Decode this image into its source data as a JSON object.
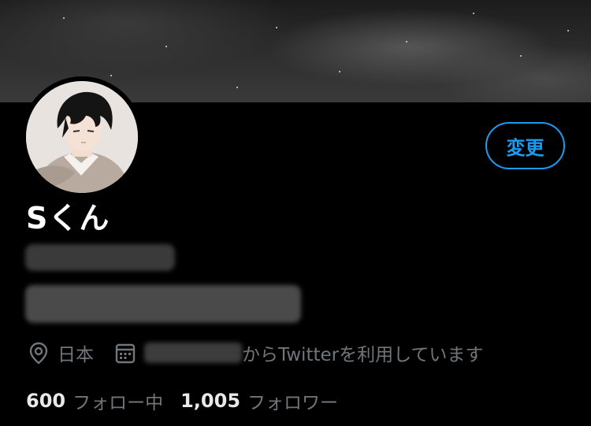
{
  "profile": {
    "display_name": "Sくん",
    "location": "日本",
    "joined_suffix": "からTwitterを利用しています",
    "edit_button_label": "変更"
  },
  "stats": {
    "following_count": "600",
    "following_label": "フォロー中",
    "followers_count": "1,005",
    "followers_label": "フォロワー"
  },
  "icons": {
    "location": "location-pin-icon",
    "joined": "calendar-icon"
  },
  "colors": {
    "background": "#000000",
    "accent": "#1d9bf0",
    "secondary_text": "#71767b",
    "primary_text": "#e7e9ea"
  }
}
